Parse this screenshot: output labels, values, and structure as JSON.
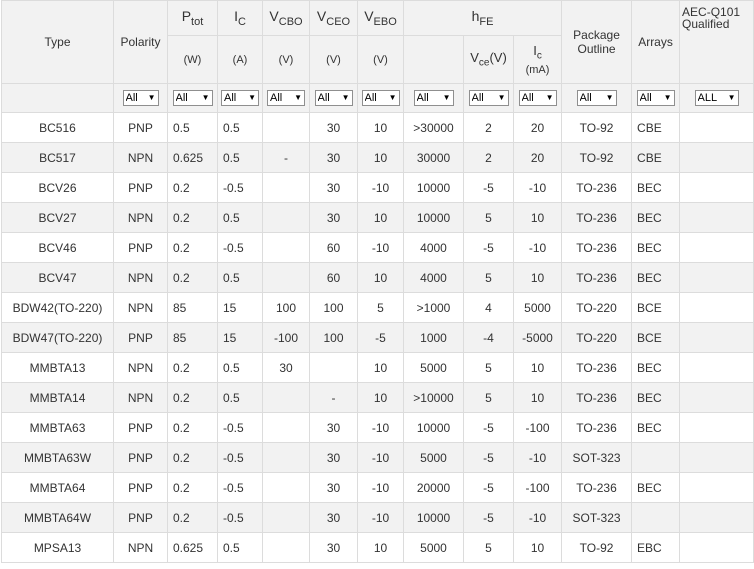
{
  "header": {
    "type": "Type",
    "polarity": "Polarity",
    "ptot": {
      "sym": "P",
      "sub": "tot",
      "unit": "(W)"
    },
    "ic": {
      "sym": "I",
      "sub": "C",
      "unit": "(A)"
    },
    "vcbo": {
      "sym": "V",
      "sub": "CBO",
      "unit": "(V)"
    },
    "vceo": {
      "sym": "V",
      "sub": "CEO",
      "unit": "(V)"
    },
    "vebo": {
      "sym": "V",
      "sub": "EBO",
      "unit": "(V)"
    },
    "hfe": {
      "sym": "h",
      "sub": "FE"
    },
    "vce": {
      "sym": "V",
      "sub": "ce",
      "unit": "(V)"
    },
    "icm": {
      "sym": "I",
      "sub": "c",
      "unit": "(mA)"
    },
    "package_outline": "Package Outline",
    "arrays": "Arrays",
    "aec": "AEC-Q101 Qualified"
  },
  "filters": {
    "polarity": "All",
    "ptot": "All",
    "ic": "All",
    "vcbo": "All",
    "vceo": "All",
    "vebo": "All",
    "hfe": "All",
    "vce": "All",
    "icm": "All",
    "package": "All",
    "arrays": "All",
    "aec": "ALL"
  },
  "rows": [
    {
      "type": "BC516",
      "polarity": "PNP",
      "ptot": "0.5",
      "ic": "0.5",
      "vcbo": "",
      "vceo": "30",
      "vebo": "10",
      "hfe": ">30000",
      "vce": "2",
      "icm": "20",
      "package": "TO-92",
      "arrays": "CBE",
      "aec": ""
    },
    {
      "type": "BC517",
      "polarity": "NPN",
      "ptot": "0.625",
      "ic": "0.5",
      "vcbo": "-",
      "vceo": "30",
      "vebo": "10",
      "hfe": "30000",
      "vce": "2",
      "icm": "20",
      "package": "TO-92",
      "arrays": "CBE",
      "aec": ""
    },
    {
      "type": "BCV26",
      "polarity": "PNP",
      "ptot": "0.2",
      "ic": "-0.5",
      "vcbo": "",
      "vceo": "30",
      "vebo": "-10",
      "hfe": "10000",
      "vce": "-5",
      "icm": "-10",
      "package": "TO-236",
      "arrays": "BEC",
      "aec": ""
    },
    {
      "type": "BCV27",
      "polarity": "NPN",
      "ptot": "0.2",
      "ic": "0.5",
      "vcbo": "",
      "vceo": "30",
      "vebo": "10",
      "hfe": "10000",
      "vce": "5",
      "icm": "10",
      "package": "TO-236",
      "arrays": "BEC",
      "aec": ""
    },
    {
      "type": "BCV46",
      "polarity": "PNP",
      "ptot": "0.2",
      "ic": "-0.5",
      "vcbo": "",
      "vceo": "60",
      "vebo": "-10",
      "hfe": "4000",
      "vce": "-5",
      "icm": "-10",
      "package": "TO-236",
      "arrays": "BEC",
      "aec": ""
    },
    {
      "type": "BCV47",
      "polarity": "NPN",
      "ptot": "0.2",
      "ic": "0.5",
      "vcbo": "",
      "vceo": "60",
      "vebo": "10",
      "hfe": "4000",
      "vce": "5",
      "icm": "10",
      "package": "TO-236",
      "arrays": "BEC",
      "aec": ""
    },
    {
      "type": "BDW42(TO-220)",
      "polarity": "NPN",
      "ptot": "85",
      "ic": "15",
      "vcbo": "100",
      "vceo": "100",
      "vebo": "5",
      "hfe": ">1000",
      "vce": "4",
      "icm": "5000",
      "package": "TO-220",
      "arrays": "BCE",
      "aec": ""
    },
    {
      "type": "BDW47(TO-220)",
      "polarity": "PNP",
      "ptot": "85",
      "ic": "15",
      "vcbo": "-100",
      "vceo": "100",
      "vebo": "-5",
      "hfe": "1000",
      "vce": "-4",
      "icm": "-5000",
      "package": "TO-220",
      "arrays": "BCE",
      "aec": ""
    },
    {
      "type": "MMBTA13",
      "polarity": "NPN",
      "ptot": "0.2",
      "ic": "0.5",
      "vcbo": "30",
      "vceo": "",
      "vebo": "10",
      "hfe": "5000",
      "vce": "5",
      "icm": "10",
      "package": "TO-236",
      "arrays": "BEC",
      "aec": ""
    },
    {
      "type": "MMBTA14",
      "polarity": "NPN",
      "ptot": "0.2",
      "ic": "0.5",
      "vcbo": "",
      "vceo": "-",
      "vebo": "10",
      "hfe": ">10000",
      "vce": "5",
      "icm": "10",
      "package": "TO-236",
      "arrays": "BEC",
      "aec": ""
    },
    {
      "type": "MMBTA63",
      "polarity": "PNP",
      "ptot": "0.2",
      "ic": "-0.5",
      "vcbo": "",
      "vceo": "30",
      "vebo": "-10",
      "hfe": "10000",
      "vce": "-5",
      "icm": "-100",
      "package": "TO-236",
      "arrays": "BEC",
      "aec": ""
    },
    {
      "type": "MMBTA63W",
      "polarity": "PNP",
      "ptot": "0.2",
      "ic": "-0.5",
      "vcbo": "",
      "vceo": "30",
      "vebo": "-10",
      "hfe": "5000",
      "vce": "-5",
      "icm": "-10",
      "package": "SOT-323",
      "arrays": "",
      "aec": ""
    },
    {
      "type": "MMBTA64",
      "polarity": "PNP",
      "ptot": "0.2",
      "ic": "-0.5",
      "vcbo": "",
      "vceo": "30",
      "vebo": "-10",
      "hfe": "20000",
      "vce": "-5",
      "icm": "-100",
      "package": "TO-236",
      "arrays": "BEC",
      "aec": ""
    },
    {
      "type": "MMBTA64W",
      "polarity": "PNP",
      "ptot": "0.2",
      "ic": "-0.5",
      "vcbo": "",
      "vceo": "30",
      "vebo": "-10",
      "hfe": "10000",
      "vce": "-5",
      "icm": "-10",
      "package": "SOT-323",
      "arrays": "",
      "aec": ""
    },
    {
      "type": "MPSA13",
      "polarity": "NPN",
      "ptot": "0.625",
      "ic": "0.5",
      "vcbo": "",
      "vceo": "30",
      "vebo": "10",
      "hfe": "5000",
      "vce": "5",
      "icm": "10",
      "package": "TO-92",
      "arrays": "EBC",
      "aec": ""
    }
  ]
}
